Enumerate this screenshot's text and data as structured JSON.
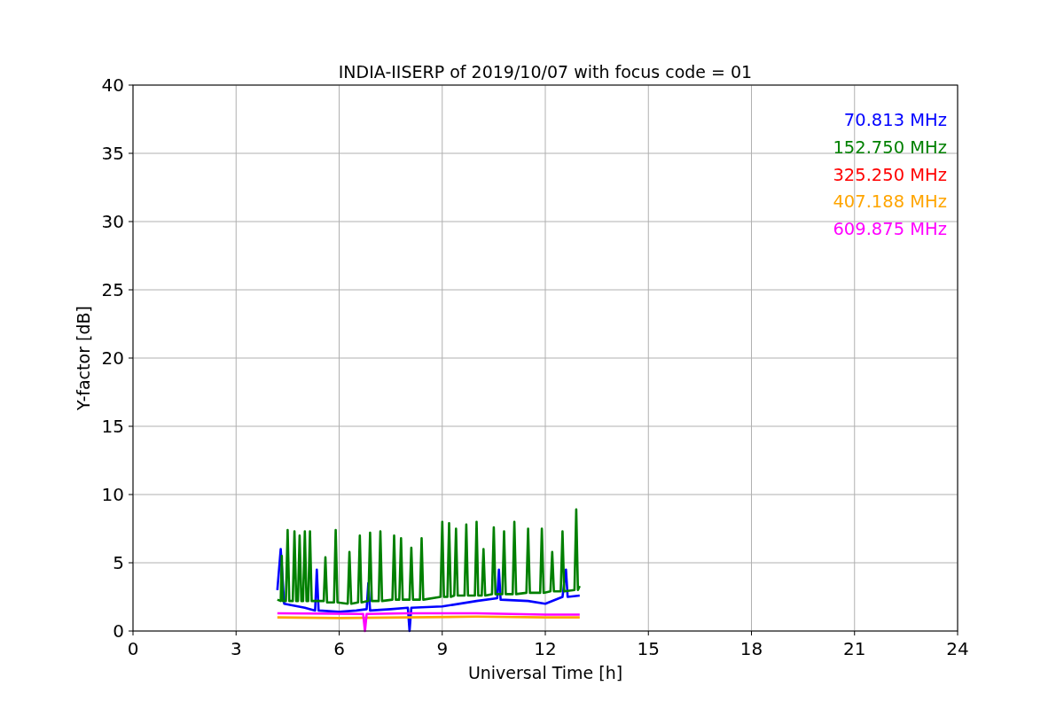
{
  "chart_data": {
    "type": "line",
    "title": "INDIA-IISERP of 2019/10/07 with focus code = 01",
    "xlabel": "Universal Time [h]",
    "ylabel": "Y-factor [dB]",
    "xlim": [
      0,
      24
    ],
    "ylim": [
      0,
      40
    ],
    "xticks": [
      0,
      3,
      6,
      9,
      12,
      15,
      18,
      21,
      24
    ],
    "yticks": [
      0,
      5,
      10,
      15,
      20,
      25,
      30,
      35,
      40
    ],
    "grid": true,
    "series": [
      {
        "name": "70.813 MHz",
        "color": "#0000ff",
        "x": [
          4.2,
          4.3,
          4.4,
          5,
          5.3,
          5.35,
          5.4,
          6,
          6.5,
          6.8,
          6.85,
          6.9,
          7.5,
          8.0,
          8.05,
          8.1,
          9,
          10,
          10.6,
          10.65,
          10.7,
          11.5,
          12,
          12.5,
          12.6,
          12.65,
          13
        ],
        "values": [
          3,
          6,
          2,
          1.7,
          1.5,
          4.5,
          1.5,
          1.4,
          1.5,
          1.6,
          3.5,
          1.5,
          1.6,
          1.7,
          0,
          1.7,
          1.8,
          2.2,
          2.4,
          4.5,
          2.3,
          2.2,
          2.0,
          2.5,
          4.5,
          2.5,
          2.6
        ]
      },
      {
        "name": "152.750 MHz",
        "color": "#008000",
        "x": [
          4.2,
          4.3,
          4.33,
          4.36,
          4.45,
          4.5,
          4.55,
          4.65,
          4.7,
          4.75,
          4.8,
          4.85,
          4.9,
          4.95,
          5.0,
          5.05,
          5.1,
          5.15,
          5.2,
          5.55,
          5.6,
          5.65,
          5.85,
          5.9,
          5.95,
          6.25,
          6.3,
          6.35,
          6.55,
          6.6,
          6.65,
          6.85,
          6.9,
          6.95,
          7.15,
          7.2,
          7.25,
          7.55,
          7.6,
          7.65,
          7.75,
          7.8,
          7.85,
          8.05,
          8.1,
          8.15,
          8.35,
          8.4,
          8.45,
          8.95,
          9.0,
          9.05,
          9.15,
          9.2,
          9.25,
          9.35,
          9.4,
          9.45,
          9.65,
          9.7,
          9.75,
          9.95,
          10.0,
          10.05,
          10.15,
          10.2,
          10.25,
          10.45,
          10.5,
          10.55,
          10.75,
          10.8,
          10.85,
          11.05,
          11.1,
          11.15,
          11.45,
          11.5,
          11.55,
          11.85,
          11.9,
          11.95,
          12.15,
          12.2,
          12.25,
          12.45,
          12.5,
          12.55,
          12.85,
          12.9,
          12.95,
          13.0
        ],
        "values": [
          2.3,
          2.2,
          5.5,
          2.2,
          2.2,
          7.4,
          2.2,
          2.2,
          7.3,
          2.2,
          2.2,
          7.0,
          2.2,
          2.2,
          7.3,
          2.2,
          2.2,
          7.3,
          2.2,
          2.2,
          5.4,
          2.1,
          2.1,
          7.4,
          2.1,
          2.0,
          5.8,
          2.0,
          2.1,
          7.0,
          2.1,
          2.2,
          7.2,
          2.2,
          2.2,
          7.3,
          2.2,
          2.3,
          7.0,
          2.3,
          2.3,
          6.8,
          2.3,
          2.3,
          6.1,
          2.3,
          2.3,
          6.8,
          2.3,
          2.5,
          8.0,
          2.5,
          2.5,
          7.9,
          2.5,
          2.6,
          7.5,
          2.6,
          2.6,
          7.8,
          2.6,
          2.6,
          8.0,
          2.6,
          2.6,
          6.0,
          2.6,
          2.7,
          7.6,
          2.7,
          2.7,
          7.3,
          2.7,
          2.7,
          8.0,
          2.7,
          2.8,
          7.5,
          2.8,
          2.8,
          7.5,
          2.8,
          2.9,
          5.8,
          2.9,
          2.9,
          7.3,
          2.9,
          3.0,
          8.9,
          3.0,
          3.3
        ]
      },
      {
        "name": "325.250 MHz",
        "color": "#ff0000"
      },
      {
        "name": "407.188 MHz",
        "color": "#ffa500",
        "x": [
          4.2,
          6,
          8,
          10,
          12,
          13
        ],
        "values": [
          1.0,
          0.95,
          1.0,
          1.05,
          1.0,
          1.0
        ]
      },
      {
        "name": "609.875 MHz",
        "color": "#ff00ff",
        "x": [
          4.2,
          6.7,
          6.75,
          6.8,
          8,
          10,
          12,
          13
        ],
        "values": [
          1.3,
          1.25,
          0,
          1.25,
          1.3,
          1.3,
          1.2,
          1.2
        ]
      }
    ]
  }
}
